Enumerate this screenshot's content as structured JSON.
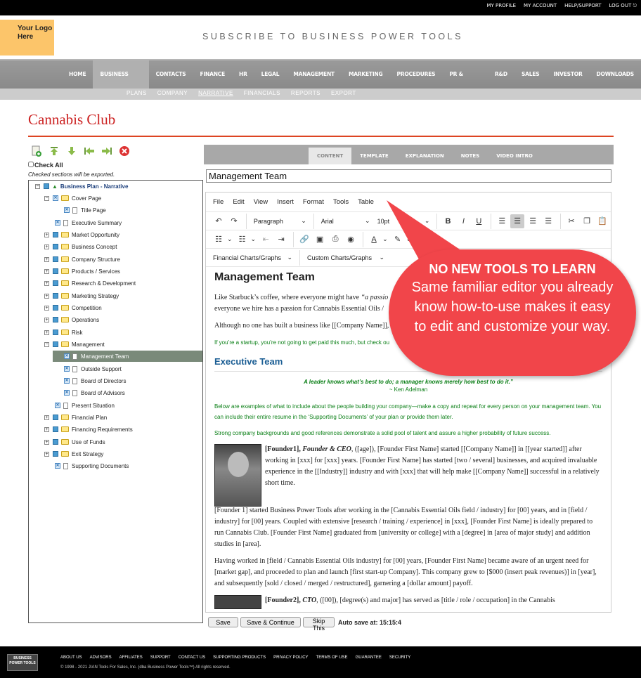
{
  "top_links": [
    "MY PROFILE",
    "MY ACCOUNT",
    "HELP/SUPPORT",
    "LOG OUT"
  ],
  "logo_text": "Your Logo Here",
  "tagline": "SUBSCRIBE TO BUSINESS POWER TOOLS",
  "main_nav": [
    "HOME",
    "BUSINESS PLAN",
    "CONTACTS",
    "FINANCE",
    "HR",
    "LEGAL",
    "MANAGEMENT",
    "MARKETING",
    "PROCEDURES",
    "PR & MEDIA",
    "R&D",
    "SALES",
    "INVESTOR",
    "DOWNLOADS"
  ],
  "sub_nav": [
    "PLANS",
    "COMPANY",
    "NARRATIVE",
    "FINANCIALS",
    "REPORTS",
    "EXPORT"
  ],
  "page_title": "Cannabis Club",
  "check_all": "Check All",
  "export_note": "Checked sections will be exported.",
  "tree": {
    "root": "Business Plan - Narrative",
    "items": [
      "Cover Page",
      "Title Page",
      "Executive Summary",
      "Market Opportunity",
      "Business Concept",
      "Company Structure",
      "Products / Services",
      "Research & Development",
      "Marketing Strategy",
      "Competition",
      "Operations",
      "Risk",
      "Management",
      "Management Team",
      "Outside Support",
      "Board of Directors",
      "Board of Advisors",
      "Present Situation",
      "Financial Plan",
      "Financing Requirements",
      "Use of Funds",
      "Exit Strategy",
      "Supporting Documents"
    ]
  },
  "editor_tabs": [
    "CONTENT",
    "TEMPLATE",
    "EXPLANATION",
    "NOTES",
    "VIDEO INTRO"
  ],
  "section_title": "Management Team",
  "menu": [
    "File",
    "Edit",
    "View",
    "Insert",
    "Format",
    "Tools",
    "Table"
  ],
  "toolbar": {
    "block_format": "Paragraph",
    "font": "Arial",
    "size": "10pt",
    "financial": "Financial Charts/Graphs",
    "custom": "Custom Charts/Graphs"
  },
  "doc": {
    "h1": "Management Team",
    "p1a": "Like Starbuck’s coffee, where everyone might have ",
    "p1b": "“a passio",
    "p1c": "everyone we hire has a passion for Cannabis Essential Oils /",
    "p2": "Although no one has built a business like [[Company Name]],",
    "g1": "If you’re a startup, you’re not going to get paid this much, but check ou",
    "h2": "Executive Team",
    "quote": "A leader knows what’s best to do; a manager knows merely how best to do it.”",
    "quote_by": "~ Ken Adelman",
    "g2": "Below are examples of what to include about the people building your company—make a copy and repeat for every person on your management team. You can include their entire resume in the ‘Supporting Documents’ of your plan or provide them later.",
    "g3": "Strong company backgrounds and good references demonstrate a solid pool of talent and assure a higher probability of future success.",
    "f1a": "[Founder1], ",
    "f1b": "Founder & CEO",
    "f1c": ", ([age]), [Founder First Name] started [[Company Name]] in [[year started]] after working in [xxx] for [xxx] years. [Founder First Name] has started [two / several] businesses, and acquired invaluable experience in the [[Industry]] industry and with [xxx] that will help make [[Company Name]] successful in a relatively short time.",
    "f1d": "[Founder 1] started Business Power Tools after working in the [Cannabis Essential Oils field / industry] for [00] years, and in [field / industry] for [00] years. Coupled with extensive [research / training / experience] in [xxx], [Founder First Name] is ideally prepared to run Cannabis Club. [Founder First Name] graduated from [university or college] with a [degree] in [area of major study] and addition studies in [area].",
    "p3": "Having worked in [field / Cannabis Essential Oils industry] for [00] years, [Founder First Name] became aware of an urgent need for [market gap], and proceeded to plan and launch [first start-up Company]. This company grew to [$000 (insert peak revenues)] in [year], and subsequently [sold / closed / merged / restructured], garnering a [dollar amount] payoff.",
    "f2a": "[Founder2], ",
    "f2b": "CTO",
    "f2c": ", ([00]), [degree(s) and major] has served as [title / role / occupation] in the Cannabis"
  },
  "callout": {
    "heading": "NO NEW TOOLS TO LEARN",
    "body": "Same familiar editor you already know how-to-use makes it easy to edit and customize your way."
  },
  "buttons": {
    "save": "Save",
    "save_continue": "Save & Continue",
    "skip": "Skip This",
    "autosave": "Auto save at: 15:15:4"
  },
  "footer": {
    "logo": "BUSINESS POWER TOOLS",
    "links": [
      "ABOUT US",
      "ADVISORS",
      "AFFILIATES",
      "SUPPORT",
      "CONTACT US",
      "SUPPORTING PRODUCTS",
      "PRIVACY POLICY",
      "TERMS OF USE",
      "GUARANTEE",
      "SECURITY"
    ],
    "copyright": "© 1998 - 2021 JIAN Tools For Sales, Inc. (dba Business Power Tools™) All rights reserved."
  }
}
